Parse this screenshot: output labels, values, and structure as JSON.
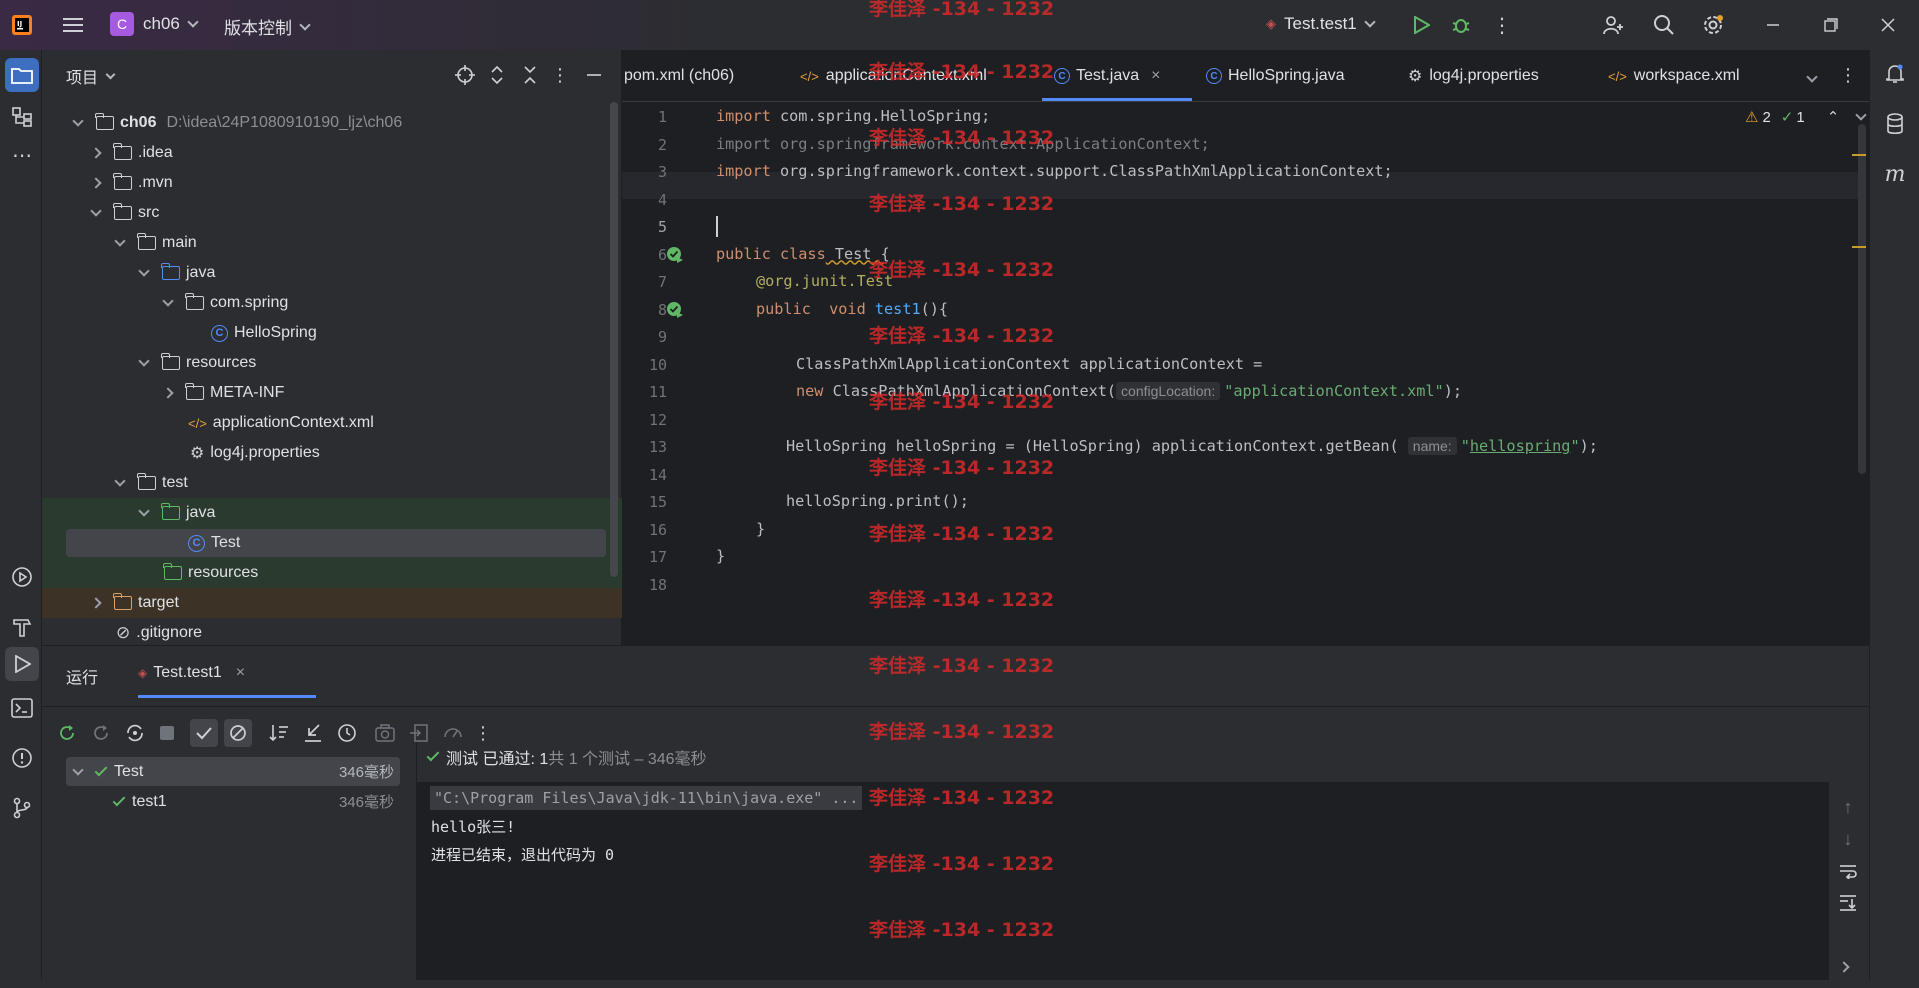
{
  "titlebar": {
    "project_badge": "C",
    "project_name": "ch06",
    "vcs_label": "版本控制",
    "run_config": "Test.test1"
  },
  "project_panel": {
    "title": "项目",
    "tree": [
      {
        "label": "ch06",
        "path": "D:\\idea\\24P1080910190_ljz\\ch06"
      },
      {
        "label": ".idea"
      },
      {
        "label": ".mvn"
      },
      {
        "label": "src"
      },
      {
        "label": "main"
      },
      {
        "label": "java"
      },
      {
        "label": "com.spring"
      },
      {
        "label": "HelloSpring"
      },
      {
        "label": "resources"
      },
      {
        "label": "META-INF"
      },
      {
        "label": "applicationContext.xml"
      },
      {
        "label": "log4j.properties"
      },
      {
        "label": "test"
      },
      {
        "label": "java"
      },
      {
        "label": "Test"
      },
      {
        "label": "resources"
      },
      {
        "label": "target"
      },
      {
        "label": ".gitignore"
      }
    ]
  },
  "editor": {
    "tabs": [
      {
        "label": "pom.xml (ch06)"
      },
      {
        "label": "applicationContext.xml"
      },
      {
        "label": "Test.java"
      },
      {
        "label": "HelloSpring.java"
      },
      {
        "label": "log4j.properties"
      },
      {
        "label": "workspace.xml"
      }
    ],
    "warnings": "2",
    "weak_warnings": "1",
    "line_numbers": [
      "1",
      "2",
      "3",
      "4",
      "5",
      "6",
      "7",
      "8",
      "9",
      "10",
      "11",
      "12",
      "13",
      "14",
      "15",
      "16",
      "17",
      "18"
    ],
    "code": {
      "l1_kw": "import",
      "l1_rest": " com.spring.HelloSpring;",
      "l2": "import org.springframework.context.ApplicationContext;",
      "l3_kw": "import",
      "l3_rest": " org.springframework.context.support.ClassPathXmlApplicationContext;",
      "l6_kw": "public class",
      "l6_rest": " Test {",
      "l7_ann": "@org.junit.",
      "l7_ann2": "Test",
      "l8_kw": "public  void",
      "l8_fn": "test1",
      "l8_rest": "(){",
      "l10": "ClassPathXmlApplicationContext applicationContext =",
      "l11_kw": "new",
      "l11_rest": " ClassPathXmlApplicationContext(",
      "l11_hint": "configLocation:",
      "l11_str": "\"applicationContext.xml\"",
      "l11_end": ");",
      "l13": "HelloSpring helloSpring = (HelloSpring) applicationContext.getBean(",
      "l13_hint": "name:",
      "l13_str_q1": "\"",
      "l13_str": "hellospring",
      "l13_str_q2": "\"",
      "l13_end": ");",
      "l15": "helloSpring.print();",
      "l16": "}",
      "l17": "}"
    }
  },
  "run_panel": {
    "title": "运行",
    "tab_label": "Test.test1",
    "tests": [
      {
        "name": "Test",
        "time": "346毫秒"
      },
      {
        "name": "test1",
        "time": "346毫秒"
      }
    ],
    "status_prefix": "测试 已通过: 1",
    "status_suffix": "共 1 个测试 – 346毫秒",
    "console": [
      "\"C:\\Program Files\\Java\\jdk-11\\bin\\java.exe\" ...",
      "hello张三!",
      "进程已结束，退出代码为 0"
    ]
  },
  "watermark": "李佳泽 -134 - 1232",
  "colors": {
    "accent": "#548af7",
    "success": "#5fb865",
    "watermark": "#d42a2a",
    "project_badge": "#a55ae0"
  }
}
